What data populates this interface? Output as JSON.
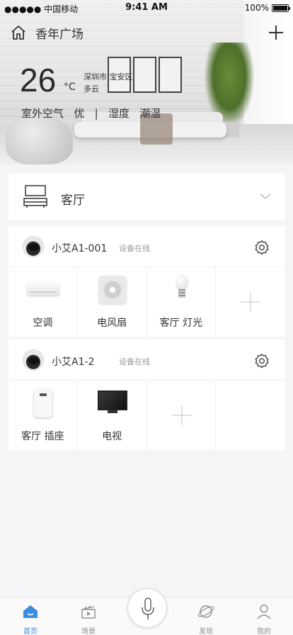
{
  "status_bar": {
    "carrier": "●●●●● 中国移动",
    "time": "9:41 AM",
    "battery": "100%"
  },
  "header": {
    "location": "香年广场"
  },
  "weather": {
    "temperature": "26",
    "unit": "°C",
    "city": "深圳市·宝安区",
    "condition": "多云",
    "air_label": "室外空气",
    "air_value": "优",
    "separator": "|",
    "humidity_label": "湿度",
    "temp_label": "潮温"
  },
  "room": {
    "name": "客厅"
  },
  "hubs": [
    {
      "name": "小艾A1-001",
      "status": "设备在线",
      "devices": [
        "空调",
        "电风扇",
        "客厅 灯光"
      ]
    },
    {
      "name": "小艾A1-2",
      "status": "设备在线",
      "devices": [
        "客厅 插座",
        "电视"
      ]
    }
  ],
  "tabs": [
    {
      "label": "首页",
      "icon": "home-icon",
      "active": true
    },
    {
      "label": "场景",
      "icon": "clapperboard-icon"
    },
    {
      "label": "发现",
      "icon": "planet-icon"
    },
    {
      "label": "我的",
      "icon": "user-icon"
    }
  ],
  "colors": {
    "accent": "#3b8be0",
    "background": "#f5f5f7"
  }
}
